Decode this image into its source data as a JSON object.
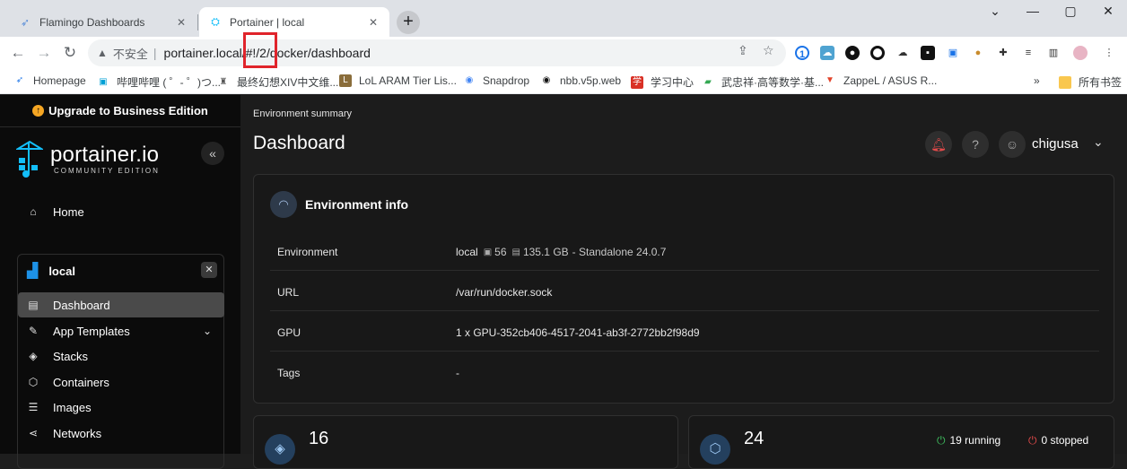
{
  "browser": {
    "tabs": [
      {
        "title": "Flamingo Dashboards",
        "active": false
      },
      {
        "title": "Portainer | local",
        "active": true
      }
    ],
    "new_tab": "+",
    "window_controls": [
      "⌄",
      "—",
      "▢",
      "✕"
    ],
    "insecure_label": "不安全",
    "url": "portainer.local/#!/2/docker/dashboard"
  },
  "bookmarks": [
    {
      "label": "Homepage",
      "icon": "rocket-icon",
      "color": "#1a73e8"
    },
    {
      "label": "哔哩哔哩 ( ゜- ゜)つ...",
      "icon": "bilibili-icon",
      "color": "#00a1d6"
    },
    {
      "label": "最终幻想XIV中文维...",
      "icon": "ffxiv-icon",
      "color": "#555555"
    },
    {
      "label": "LoL ARAM Tier Lis...",
      "icon": "lol-icon",
      "color": "#8a6d3b"
    },
    {
      "label": "Snapdrop",
      "icon": "snapdrop-icon",
      "color": "#4285f4"
    },
    {
      "label": "nbb.v5p.web",
      "icon": "nbb-icon",
      "color": "#111111"
    },
    {
      "label": "学习中心",
      "icon": "study-icon",
      "color": "#d93025"
    },
    {
      "label": "武忠祥·高等数学·基...",
      "icon": "math-icon",
      "color": "#34a853"
    },
    {
      "label": "ZappeL / ASUS R...",
      "icon": "gitlab-icon",
      "color": "#e2432a"
    },
    {
      "label": "所有书签",
      "icon": "folder-icon",
      "color": "#f9c74f"
    }
  ],
  "more_bookmarks": "»",
  "sidebar": {
    "upgrade": "Upgrade to Business Edition",
    "logo_main": "portainer.io",
    "logo_sub": "COMMUNITY EDITION",
    "collapse": "«",
    "home": "Home",
    "environment": "local",
    "env_close": "✕",
    "items": [
      {
        "label": "Dashboard",
        "icon": "dashboard-icon"
      },
      {
        "label": "App Templates",
        "icon": "edit-icon"
      },
      {
        "label": "Stacks",
        "icon": "layers-icon"
      },
      {
        "label": "Containers",
        "icon": "cube-icon"
      },
      {
        "label": "Images",
        "icon": "list-icon"
      },
      {
        "label": "Networks",
        "icon": "network-icon"
      }
    ]
  },
  "header": {
    "breadcrumb": "Environment summary",
    "title": "Dashboard",
    "username": "chigusa"
  },
  "env_info": {
    "title": "Environment info",
    "rows": [
      {
        "label": "Environment",
        "name": "local",
        "cpu": "56",
        "memory": "135.1 GB",
        "detail": "- Standalone 24.0.7"
      },
      {
        "label": "URL",
        "value": "/var/run/docker.sock"
      },
      {
        "label": "GPU",
        "value": "1 x GPU-352cb406-4517-2041-ab3f-2772bb2f98d9"
      },
      {
        "label": "Tags",
        "value": "-"
      }
    ]
  },
  "stats": {
    "stacks_count": "16",
    "containers_count": "24",
    "running": "19 running",
    "stopped": "0 stopped"
  },
  "colors": {
    "sidebar_bg": "#0b0b0b",
    "main_bg": "#1c1c1c",
    "accent_red": "#e0242b",
    "running_green": "#3fbf5f",
    "stopped_red": "#e24a4a"
  }
}
